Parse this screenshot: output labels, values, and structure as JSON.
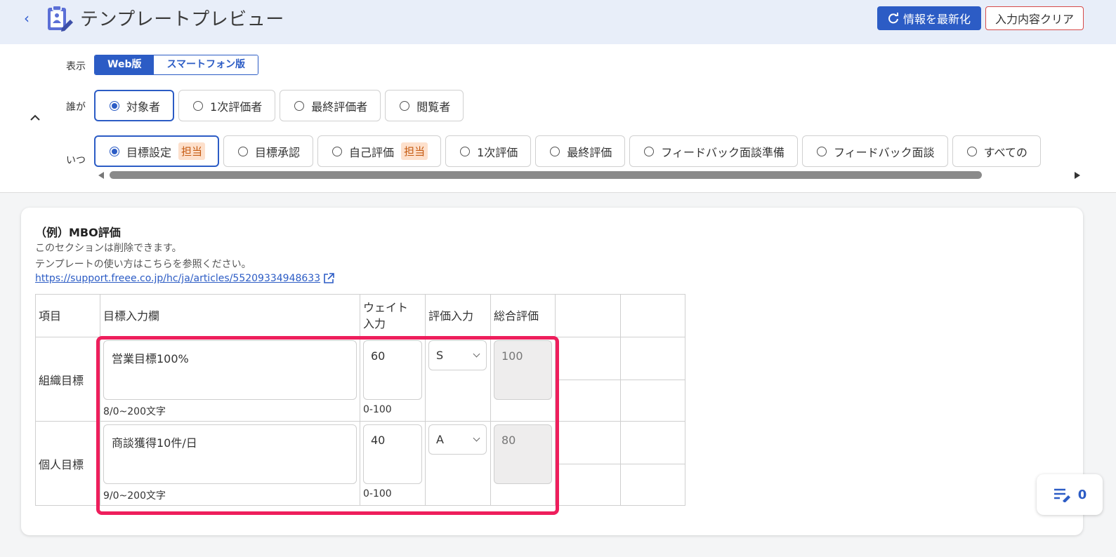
{
  "header": {
    "title": "テンプレートプレビュー",
    "refresh_label": "情報を最新化",
    "clear_label": "入力内容クリア"
  },
  "display": {
    "label": "表示",
    "options": [
      "Web版",
      "スマートフォン版"
    ],
    "selected": "Web版"
  },
  "who": {
    "label": "誰が",
    "options": [
      "対象者",
      "1次評価者",
      "最終評価者",
      "閲覧者"
    ],
    "selected": "対象者"
  },
  "when": {
    "label": "いつ",
    "options": [
      {
        "label": "目標設定",
        "tag": "担当"
      },
      {
        "label": "目標承認",
        "tag": ""
      },
      {
        "label": "自己評価",
        "tag": "担当"
      },
      {
        "label": "1次評価",
        "tag": ""
      },
      {
        "label": "最終評価",
        "tag": ""
      },
      {
        "label": "フィードバック面談準備",
        "tag": ""
      },
      {
        "label": "フィードバック面談",
        "tag": ""
      },
      {
        "label": "すべての",
        "tag": ""
      }
    ],
    "selected": "目標設定"
  },
  "section": {
    "title": "（例）MBO評価",
    "desc1": "このセクションは削除できます。",
    "desc2": "テンプレートの使い方はこちらを参照ください。",
    "link": "https://support.freee.co.jp/hc/ja/articles/55209334948633"
  },
  "table": {
    "headers": [
      "項目",
      "目標入力欄",
      "ウェイト入力",
      "評価入力",
      "総合評価",
      "",
      ""
    ],
    "header_weight_line1": "ウェイト",
    "header_weight_line2": "入力",
    "rows": [
      {
        "item": "組織目標",
        "goal": "営業目標100%",
        "goal_hint": "8/0~200文字",
        "weight": "60",
        "weight_hint": "0-100",
        "rating": "S",
        "total": "100"
      },
      {
        "item": "個人目標",
        "goal": "商談獲得10件/日",
        "goal_hint": "9/0~200文字",
        "weight": "40",
        "weight_hint": "0-100",
        "rating": "A",
        "total": "80"
      }
    ]
  },
  "comments": {
    "count": "0"
  },
  "colors": {
    "accent": "#2c5cc5",
    "highlight": "#ee1e5c",
    "header_bg": "#e8eef9",
    "tag_bg": "#fde0cc"
  },
  "icons": [
    "chevron-left-icon",
    "clipboard-edit-icon",
    "refresh-icon",
    "chevron-up-icon",
    "external-link-icon",
    "comment-list-icon",
    "chevron-down-icon"
  ]
}
